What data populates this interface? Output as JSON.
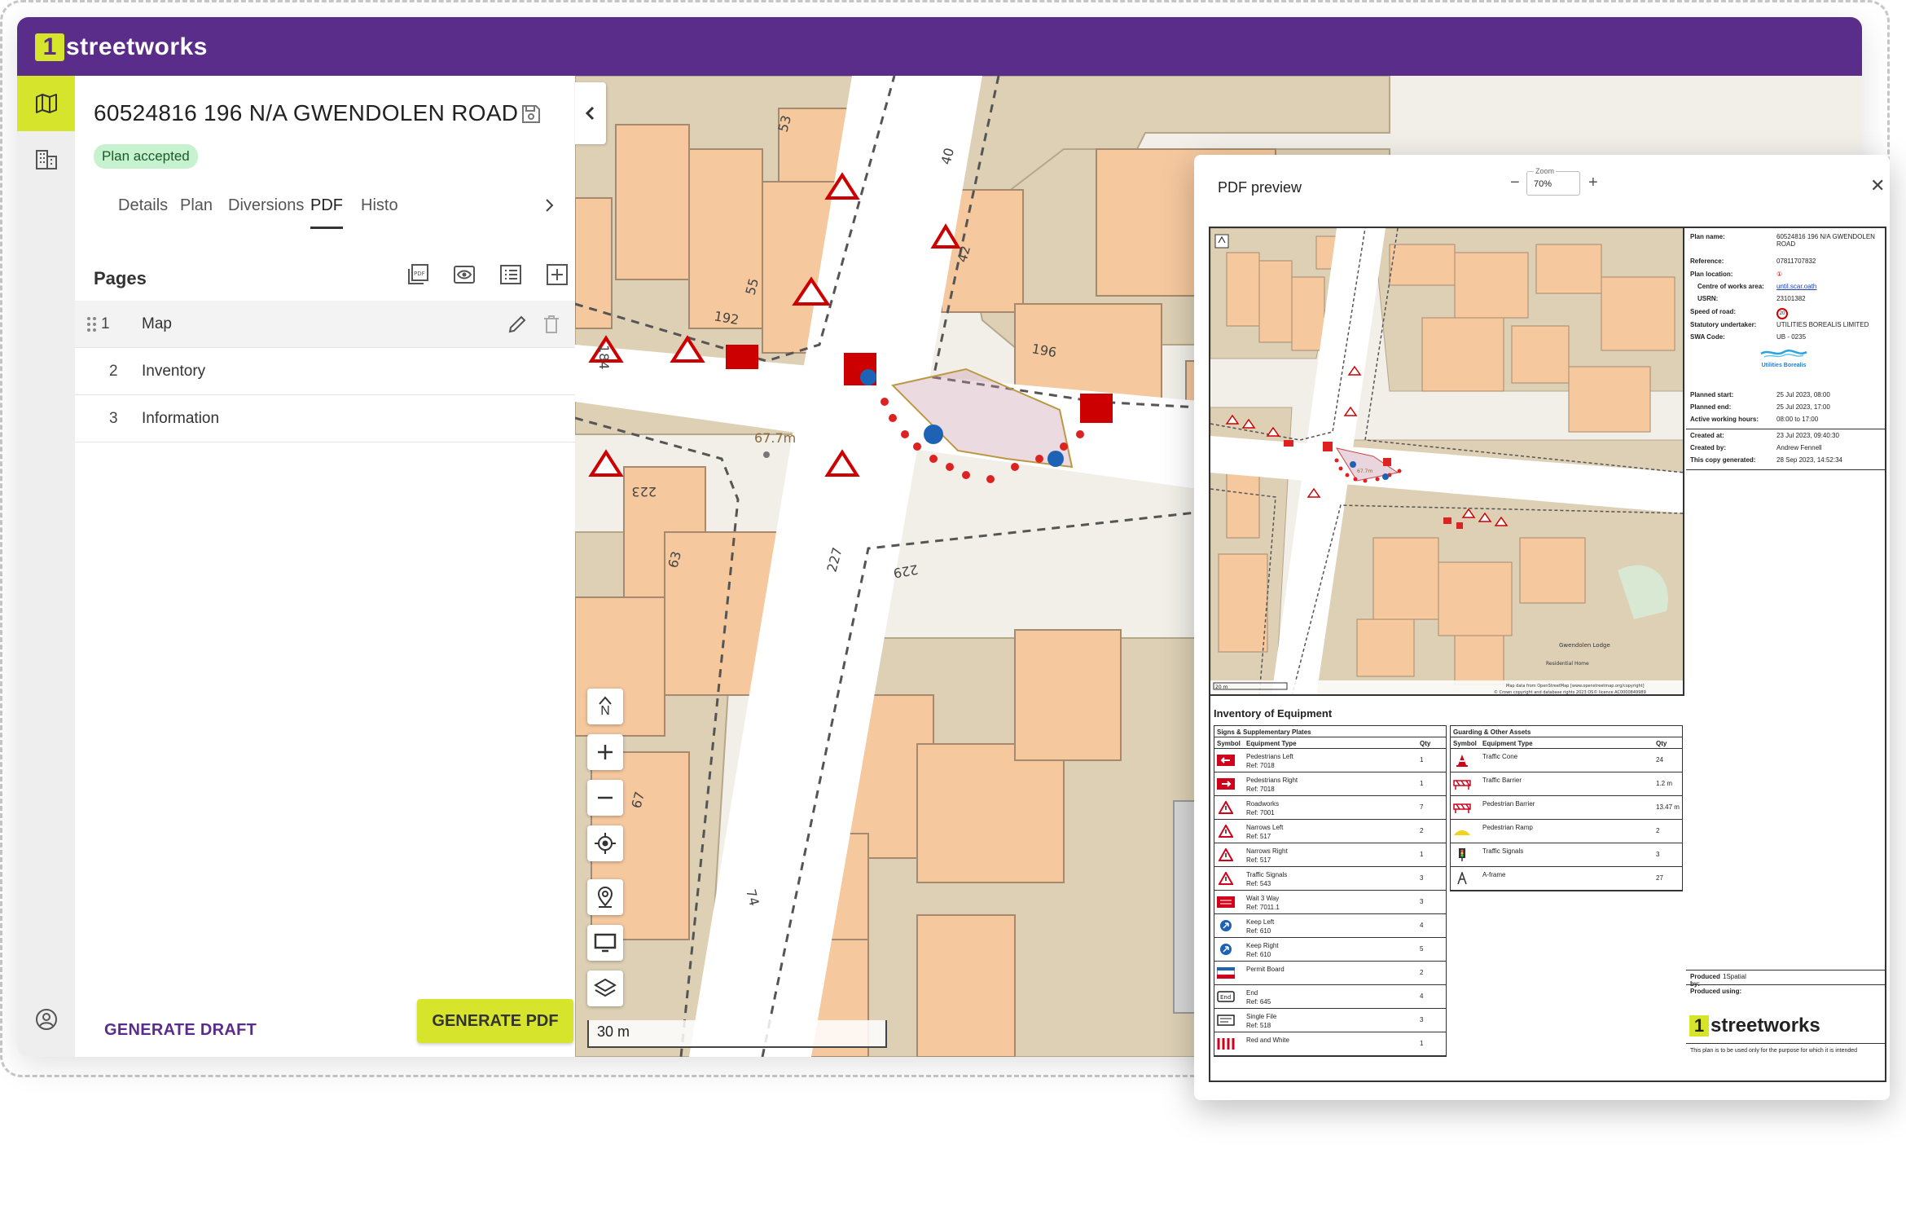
{
  "app": {
    "logo_badge": "1",
    "logo_text": "streetworks",
    "brand_purple": "#5b2d8a",
    "brand_lime": "#d7e42c"
  },
  "rail": {
    "items": [
      "map-icon",
      "buildings-icon",
      "account-icon"
    ]
  },
  "panel": {
    "title": "60524816 196 N/A GWENDOLEN ROAD",
    "status": "Plan accepted",
    "tabs": [
      "Details",
      "Plan",
      "Diversions",
      "PDF",
      "Histo"
    ],
    "active_tab": "PDF",
    "pages_heading": "Pages",
    "pages": [
      {
        "num": "1",
        "label": "Map"
      },
      {
        "num": "2",
        "label": "Inventory"
      },
      {
        "num": "3",
        "label": "Information"
      }
    ],
    "generate_draft": "GENERATE DRAFT",
    "generate_pdf": "GENERATE PDF"
  },
  "map": {
    "scale": "30 m",
    "measure": "67.7m",
    "north": "N",
    "road_numbers": [
      "53",
      "40",
      "42",
      "184",
      "55",
      "192",
      "196",
      "223",
      "63",
      "227",
      "229",
      "67",
      "74"
    ],
    "sign_end": "End"
  },
  "preview": {
    "title": "PDF preview",
    "zoom_label": "Zoom",
    "zoom_value": "70%",
    "zoom_minus": "−",
    "zoom_plus": "+",
    "close": "✕",
    "map_scale": "20 m",
    "map_measure": "67.7m",
    "place_label": "Gwendolen Lodge",
    "place_label2": "Residential Home",
    "attribution1": "Map data from OpenStreetMap [www.openstreetmap.org/copyright]",
    "attribution2": "© Crown copyright and database rights 2023 OS© licence AC0000849989",
    "info": [
      {
        "k": "Plan name:",
        "v": "60524816 196 N/A GWENDOLEN ROAD"
      },
      {
        "k": "Reference:",
        "v": "07811707832"
      },
      {
        "k": "Plan location:",
        "v": "①"
      },
      {
        "k": "Centre of works area:",
        "v": "until.scar.oath"
      },
      {
        "k": "USRN:",
        "v": "23101382"
      },
      {
        "k": "Speed of road:",
        "v": "20"
      },
      {
        "k": "Statutory undertaker:",
        "v": "UTILITIES BOREALIS LIMITED"
      },
      {
        "k": "SWA Code:",
        "v": "UB - 0235"
      }
    ],
    "util_logo": "Utilities Borealis",
    "dates": [
      {
        "k": "Planned start:",
        "v": "25 Jul 2023, 08:00"
      },
      {
        "k": "Planned end:",
        "v": "25 Jul 2023, 17:00"
      },
      {
        "k": "Active working hours:",
        "v": "08:00 to 17:00"
      }
    ],
    "created": [
      {
        "k": "Created at:",
        "v": "23 Jul 2023, 09:40:30"
      },
      {
        "k": "Created by:",
        "v": "Andrew Fennell"
      },
      {
        "k": "This copy generated:",
        "v": "28 Sep 2023, 14:52:34"
      }
    ],
    "produced_by_k": "Produced by:",
    "produced_by_v": "1Spatial",
    "produced_using": "Produced using:",
    "footer_note": "This plan is to be used only for the purpose for which it is intended",
    "inventory_title": "Inventory of Equipment",
    "signs_table": {
      "title": "Signs & Supplementary Plates",
      "cols": [
        "Symbol",
        "Equipment Type",
        "Qty"
      ],
      "rows": [
        {
          "name": "Pedestrians Left",
          "ref": "Ref: 7018",
          "qty": "1",
          "icon": "ped-left"
        },
        {
          "name": "Pedestrians Right",
          "ref": "Ref: 7018",
          "qty": "1",
          "icon": "ped-right"
        },
        {
          "name": "Roadworks",
          "ref": "Ref: 7001",
          "qty": "7",
          "icon": "triangle"
        },
        {
          "name": "Narrows Left",
          "ref": "Ref: 517",
          "qty": "2",
          "icon": "triangle"
        },
        {
          "name": "Narrows Right",
          "ref": "Ref: 517",
          "qty": "1",
          "icon": "triangle"
        },
        {
          "name": "Traffic Signals",
          "ref": "Ref: 543",
          "qty": "3",
          "icon": "triangle"
        },
        {
          "name": "Wait 3 Way",
          "ref": "Ref: 7011.1",
          "qty": "3",
          "icon": "red-board"
        },
        {
          "name": "Keep Left",
          "ref": "Ref: 610",
          "qty": "4",
          "icon": "blue-circle"
        },
        {
          "name": "Keep Right",
          "ref": "Ref: 610",
          "qty": "5",
          "icon": "blue-circle"
        },
        {
          "name": "Permit Board",
          "ref": "",
          "qty": "2",
          "icon": "permit"
        },
        {
          "name": "End",
          "ref": "Ref: 645",
          "qty": "4",
          "icon": "end"
        },
        {
          "name": "Single File",
          "ref": "Ref: 518",
          "qty": "3",
          "icon": "single"
        },
        {
          "name": "Red and White",
          "ref": "",
          "qty": "1",
          "icon": "stripes"
        }
      ]
    },
    "guard_table": {
      "title": "Guarding & Other Assets",
      "cols": [
        "Symbol",
        "Equipment Type",
        "Qty"
      ],
      "rows": [
        {
          "name": "Traffic Cone",
          "qty": "24",
          "icon": "cone"
        },
        {
          "name": "Traffic Barrier",
          "qty": "1.2 m",
          "icon": "barrier"
        },
        {
          "name": "Pedestrian Barrier",
          "qty": "13.47 m",
          "icon": "barrier"
        },
        {
          "name": "Pedestrian Ramp",
          "qty": "2",
          "icon": "ramp"
        },
        {
          "name": "Traffic Signals",
          "qty": "3",
          "icon": "signals"
        },
        {
          "name": "A-frame",
          "qty": "27",
          "icon": "aframe"
        }
      ]
    }
  }
}
